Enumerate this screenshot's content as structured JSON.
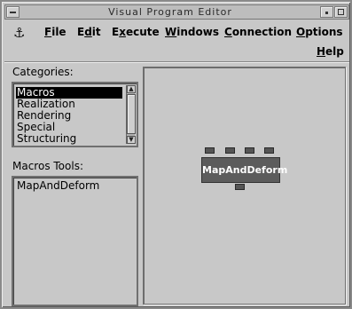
{
  "window": {
    "title": "Visual Program Editor"
  },
  "menubar": {
    "items": [
      {
        "pre": "",
        "mn": "F",
        "post": "ile"
      },
      {
        "pre": "E",
        "mn": "d",
        "post": "it"
      },
      {
        "pre": "E",
        "mn": "x",
        "post": "ecute"
      },
      {
        "pre": "",
        "mn": "W",
        "post": "indows"
      },
      {
        "pre": "",
        "mn": "C",
        "post": "onnection"
      },
      {
        "pre": "",
        "mn": "O",
        "post": "ptions"
      }
    ],
    "help": {
      "pre": "",
      "mn": "H",
      "post": "elp"
    }
  },
  "categories": {
    "label": "Categories:",
    "items": [
      "Macros",
      "Realization",
      "Rendering",
      "Special",
      "Structuring"
    ],
    "selected_index": 0
  },
  "tools": {
    "label": "Macros Tools:",
    "items": [
      "MapAndDeform"
    ]
  },
  "canvas": {
    "node": {
      "label": "MapAndDeform",
      "inputs": 4,
      "outputs": 1
    }
  }
}
